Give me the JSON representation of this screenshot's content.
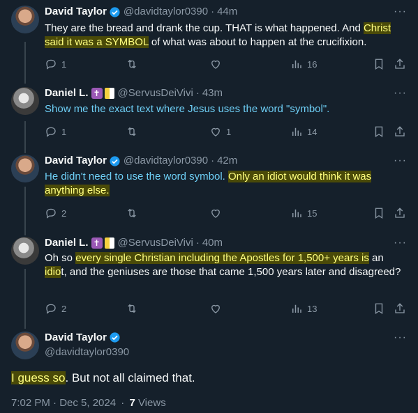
{
  "tweets": [
    {
      "name": "David Taylor",
      "handle": "@davidtaylor0390",
      "time": "44m",
      "text_parts": [
        "They are the bread and drank the cup. THAT is what happened. And ",
        "Christ said it was a SYMBOL",
        " of what was about to happen at the crucifixion."
      ],
      "replies": "1",
      "likes": "",
      "views": "16"
    },
    {
      "name": "Daniel L.",
      "handle": "@ServusDeiVivi",
      "time": "43m",
      "text": "Show me the exact text where Jesus uses the word \"symbol\".",
      "replies": "1",
      "likes": "1",
      "views": "14"
    },
    {
      "name": "David Taylor",
      "handle": "@davidtaylor0390",
      "time": "42m",
      "text_parts": [
        "He didn't need to use the word symbol. ",
        "Only an idiot would think it was anything else."
      ],
      "replies": "2",
      "likes": "",
      "views": "15"
    },
    {
      "name": "Daniel L.",
      "handle": "@ServusDeiVivi",
      "time": "40m",
      "text_parts": [
        "Oh so ",
        "every single Christian including the Apostles for 1,500+ years is",
        " an ",
        "idio",
        "t, and the geniuses are those that came 1,500 years later and disagreed?"
      ],
      "replies": "2",
      "likes": "",
      "views": "13"
    }
  ],
  "main": {
    "name": "David Taylor",
    "handle": "@davidtaylor0390",
    "text_parts": [
      "I guess so",
      ". But not all claimed that."
    ],
    "timestamp": "7:02 PM · Dec 5, 2024",
    "views_count": "7",
    "views_label": "Views"
  },
  "separator": "·",
  "more_glyph": "···",
  "colors": {
    "background": "#15202b",
    "verified": "#1d9bf0",
    "secondary": "#8b98a5"
  }
}
